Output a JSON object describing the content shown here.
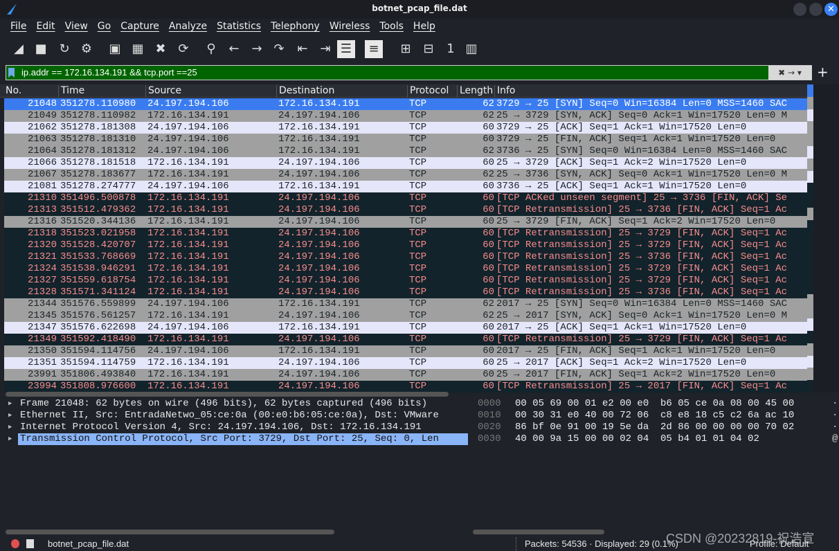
{
  "window": {
    "title": "botnet_pcap_file.dat"
  },
  "menu": [
    "File",
    "Edit",
    "View",
    "Go",
    "Capture",
    "Analyze",
    "Statistics",
    "Telephony",
    "Wireless",
    "Tools",
    "Help"
  ],
  "toolbar": [
    "start-capture",
    "stop-capture",
    "restart-capture",
    "capture-options",
    "open-file",
    "save-file",
    "close-file",
    "reload-file",
    "find-packet",
    "go-back",
    "go-forward",
    "go-to-packet",
    "first-packet",
    "last-packet",
    "autoscroll",
    "colorize",
    "zoom-in",
    "zoom-out",
    "normal-size",
    "resize-columns"
  ],
  "filter": {
    "value": "ip.addr == 172.16.134.191 && tcp.port ==25",
    "apply": "→",
    "clear": "✖"
  },
  "columns": [
    "No.",
    "Time",
    "Source",
    "Destination",
    "Protocol",
    "Length",
    "Info"
  ],
  "packets": [
    {
      "no": "21048",
      "time": "351278.110980",
      "src": "24.197.194.106",
      "dst": "172.16.134.191",
      "proto": "TCP",
      "len": "62",
      "info": "3729 → 25 [SYN] Seq=0 Win=16384 Len=0 MSS=1460 SAC",
      "style": "sel"
    },
    {
      "no": "21049",
      "time": "351278.110982",
      "src": "172.16.134.191",
      "dst": "24.197.194.106",
      "proto": "TCP",
      "len": "62",
      "info": "25 → 3729 [SYN, ACK] Seq=0 Ack=1 Win=17520 Len=0 M",
      "style": "gray"
    },
    {
      "no": "21062",
      "time": "351278.181308",
      "src": "24.197.194.106",
      "dst": "172.16.134.191",
      "proto": "TCP",
      "len": "60",
      "info": "3729 → 25 [ACK] Seq=1 Ack=1 Win=17520 Len=0",
      "style": "light"
    },
    {
      "no": "21063",
      "time": "351278.181310",
      "src": "24.197.194.106",
      "dst": "172.16.134.191",
      "proto": "TCP",
      "len": "60",
      "info": "3729 → 25 [FIN, ACK] Seq=1 Ack=1 Win=17520 Len=0",
      "style": "gray"
    },
    {
      "no": "21064",
      "time": "351278.181312",
      "src": "24.197.194.106",
      "dst": "172.16.134.191",
      "proto": "TCP",
      "len": "62",
      "info": "3736 → 25 [SYN] Seq=0 Win=16384 Len=0 MSS=1460 SAC",
      "style": "gray"
    },
    {
      "no": "21066",
      "time": "351278.181518",
      "src": "172.16.134.191",
      "dst": "24.197.194.106",
      "proto": "TCP",
      "len": "60",
      "info": "25 → 3729 [ACK] Seq=1 Ack=2 Win=17520 Len=0",
      "style": "light"
    },
    {
      "no": "21067",
      "time": "351278.183677",
      "src": "172.16.134.191",
      "dst": "24.197.194.106",
      "proto": "TCP",
      "len": "62",
      "info": "25 → 3736 [SYN, ACK] Seq=0 Ack=1 Win=17520 Len=0 M",
      "style": "gray"
    },
    {
      "no": "21081",
      "time": "351278.274777",
      "src": "24.197.194.106",
      "dst": "172.16.134.191",
      "proto": "TCP",
      "len": "60",
      "info": "3736 → 25 [ACK] Seq=1 Ack=1 Win=17520 Len=0",
      "style": "light"
    },
    {
      "no": "21310",
      "time": "351496.500878",
      "src": "172.16.134.191",
      "dst": "24.197.194.106",
      "proto": "TCP",
      "len": "60",
      "info": "[TCP ACKed unseen segment] 25 → 3736 [FIN, ACK] Se",
      "style": "dark"
    },
    {
      "no": "21313",
      "time": "351512.479362",
      "src": "172.16.134.191",
      "dst": "24.197.194.106",
      "proto": "TCP",
      "len": "60",
      "info": "[TCP Retransmission] 25 → 3736 [FIN, ACK] Seq=1 Ac",
      "style": "dark"
    },
    {
      "no": "21316",
      "time": "351520.344136",
      "src": "172.16.134.191",
      "dst": "24.197.194.106",
      "proto": "TCP",
      "len": "60",
      "info": "25 → 3729 [FIN, ACK] Seq=1 Ack=2 Win=17520 Len=0",
      "style": "gray"
    },
    {
      "no": "21318",
      "time": "351523.021958",
      "src": "172.16.134.191",
      "dst": "24.197.194.106",
      "proto": "TCP",
      "len": "60",
      "info": "[TCP Retransmission] 25 → 3729 [FIN, ACK] Seq=1 Ac",
      "style": "dark"
    },
    {
      "no": "21320",
      "time": "351528.420707",
      "src": "172.16.134.191",
      "dst": "24.197.194.106",
      "proto": "TCP",
      "len": "60",
      "info": "[TCP Retransmission] 25 → 3729 [FIN, ACK] Seq=1 Ac",
      "style": "dark"
    },
    {
      "no": "21321",
      "time": "351533.768669",
      "src": "172.16.134.191",
      "dst": "24.197.194.106",
      "proto": "TCP",
      "len": "60",
      "info": "[TCP Retransmission] 25 → 3736 [FIN, ACK] Seq=1 Ac",
      "style": "dark"
    },
    {
      "no": "21324",
      "time": "351538.946291",
      "src": "172.16.134.191",
      "dst": "24.197.194.106",
      "proto": "TCP",
      "len": "60",
      "info": "[TCP Retransmission] 25 → 3729 [FIN, ACK] Seq=1 Ac",
      "style": "dark"
    },
    {
      "no": "21327",
      "time": "351559.618754",
      "src": "172.16.134.191",
      "dst": "24.197.194.106",
      "proto": "TCP",
      "len": "60",
      "info": "[TCP Retransmission] 25 → 3729 [FIN, ACK] Seq=1 Ac",
      "style": "dark"
    },
    {
      "no": "21328",
      "time": "351571.341124",
      "src": "172.16.134.191",
      "dst": "24.197.194.106",
      "proto": "TCP",
      "len": "60",
      "info": "[TCP Retransmission] 25 → 3736 [FIN, ACK] Seq=1 Ac",
      "style": "dark"
    },
    {
      "no": "21344",
      "time": "351576.559899",
      "src": "24.197.194.106",
      "dst": "172.16.134.191",
      "proto": "TCP",
      "len": "62",
      "info": "2017 → 25 [SYN] Seq=0 Win=16384 Len=0 MSS=1460 SAC",
      "style": "gray"
    },
    {
      "no": "21345",
      "time": "351576.561257",
      "src": "172.16.134.191",
      "dst": "24.197.194.106",
      "proto": "TCP",
      "len": "62",
      "info": "25 → 2017 [SYN, ACK] Seq=0 Ack=1 Win=17520 Len=0 M",
      "style": "gray"
    },
    {
      "no": "21347",
      "time": "351576.622698",
      "src": "24.197.194.106",
      "dst": "172.16.134.191",
      "proto": "TCP",
      "len": "60",
      "info": "2017 → 25 [ACK] Seq=1 Ack=1 Win=17520 Len=0",
      "style": "light"
    },
    {
      "no": "21349",
      "time": "351592.418490",
      "src": "172.16.134.191",
      "dst": "24.197.194.106",
      "proto": "TCP",
      "len": "60",
      "info": "[TCP Retransmission] 25 → 3729 [FIN, ACK] Seq=1 Ac",
      "style": "dark"
    },
    {
      "no": "21350",
      "time": "351594.114756",
      "src": "24.197.194.106",
      "dst": "172.16.134.191",
      "proto": "TCP",
      "len": "60",
      "info": "2017 → 25 [FIN, ACK] Seq=1 Ack=1 Win=17520 Len=0",
      "style": "gray"
    },
    {
      "no": "21351",
      "time": "351594.114759",
      "src": "172.16.134.191",
      "dst": "24.197.194.106",
      "proto": "TCP",
      "len": "60",
      "info": "25 → 2017 [ACK] Seq=1 Ack=2 Win=17520 Len=0",
      "style": "light"
    },
    {
      "no": "23991",
      "time": "351806.493840",
      "src": "172.16.134.191",
      "dst": "24.197.194.106",
      "proto": "TCP",
      "len": "60",
      "info": "25 → 2017 [FIN, ACK] Seq=1 Ack=2 Win=17520 Len=0",
      "style": "gray"
    },
    {
      "no": "23994",
      "time": "351808.976600",
      "src": "172.16.134.191",
      "dst": "24.197.194.106",
      "proto": "TCP",
      "len": "60",
      "info": "[TCP Retransmission] 25 → 2017 [FIN, ACK] Seq=1 Ac",
      "style": "dark"
    }
  ],
  "details": [
    {
      "text": "Frame 21048: 62 bytes on wire (496 bits), 62 bytes captured (496 bits)",
      "selected": false
    },
    {
      "text": "Ethernet II, Src: EntradaNetwo_05:ce:0a (00:e0:b6:05:ce:0a), Dst: VMware",
      "selected": false
    },
    {
      "text": "Internet Protocol Version 4, Src: 24.197.194.106, Dst: 172.16.134.191",
      "selected": false
    },
    {
      "text": "Transmission Control Protocol, Src Port: 3729, Dst Port: 25, Seq: 0, Len",
      "selected": true
    }
  ],
  "hex": [
    {
      "offset": "0000",
      "bytes": "00 05 69 00 01 e2 00 e0  b6 05 ce 0a 08 00 45 00",
      "ascii": "·"
    },
    {
      "offset": "0010",
      "bytes": "00 30 31 e0 40 00 72 06  c8 e8 18 c5 c2 6a ac 10",
      "ascii": "·"
    },
    {
      "offset": "0020",
      "bytes": "86 bf 0e 91 00 19 5e da  2d 86 00 00 00 00 70 02",
      "ascii": "·"
    },
    {
      "offset": "0030",
      "bytes": "40 00 9a 15 00 00 02 04  05 b4 01 01 04 02",
      "ascii": "@"
    }
  ],
  "status": {
    "file": "botnet_pcap_file.dat",
    "packets": "Packets: 54536 · Displayed: 29 (0.1%)",
    "profile": "Profile: Default",
    "watermark": "CSDN @20232819-祝浩宣"
  },
  "colors": {
    "selected": "#3a7cf0",
    "filter_ok": "#006400",
    "bad_tcp_bg": "#12232b",
    "bad_tcp_fg": "#f78c8c"
  }
}
